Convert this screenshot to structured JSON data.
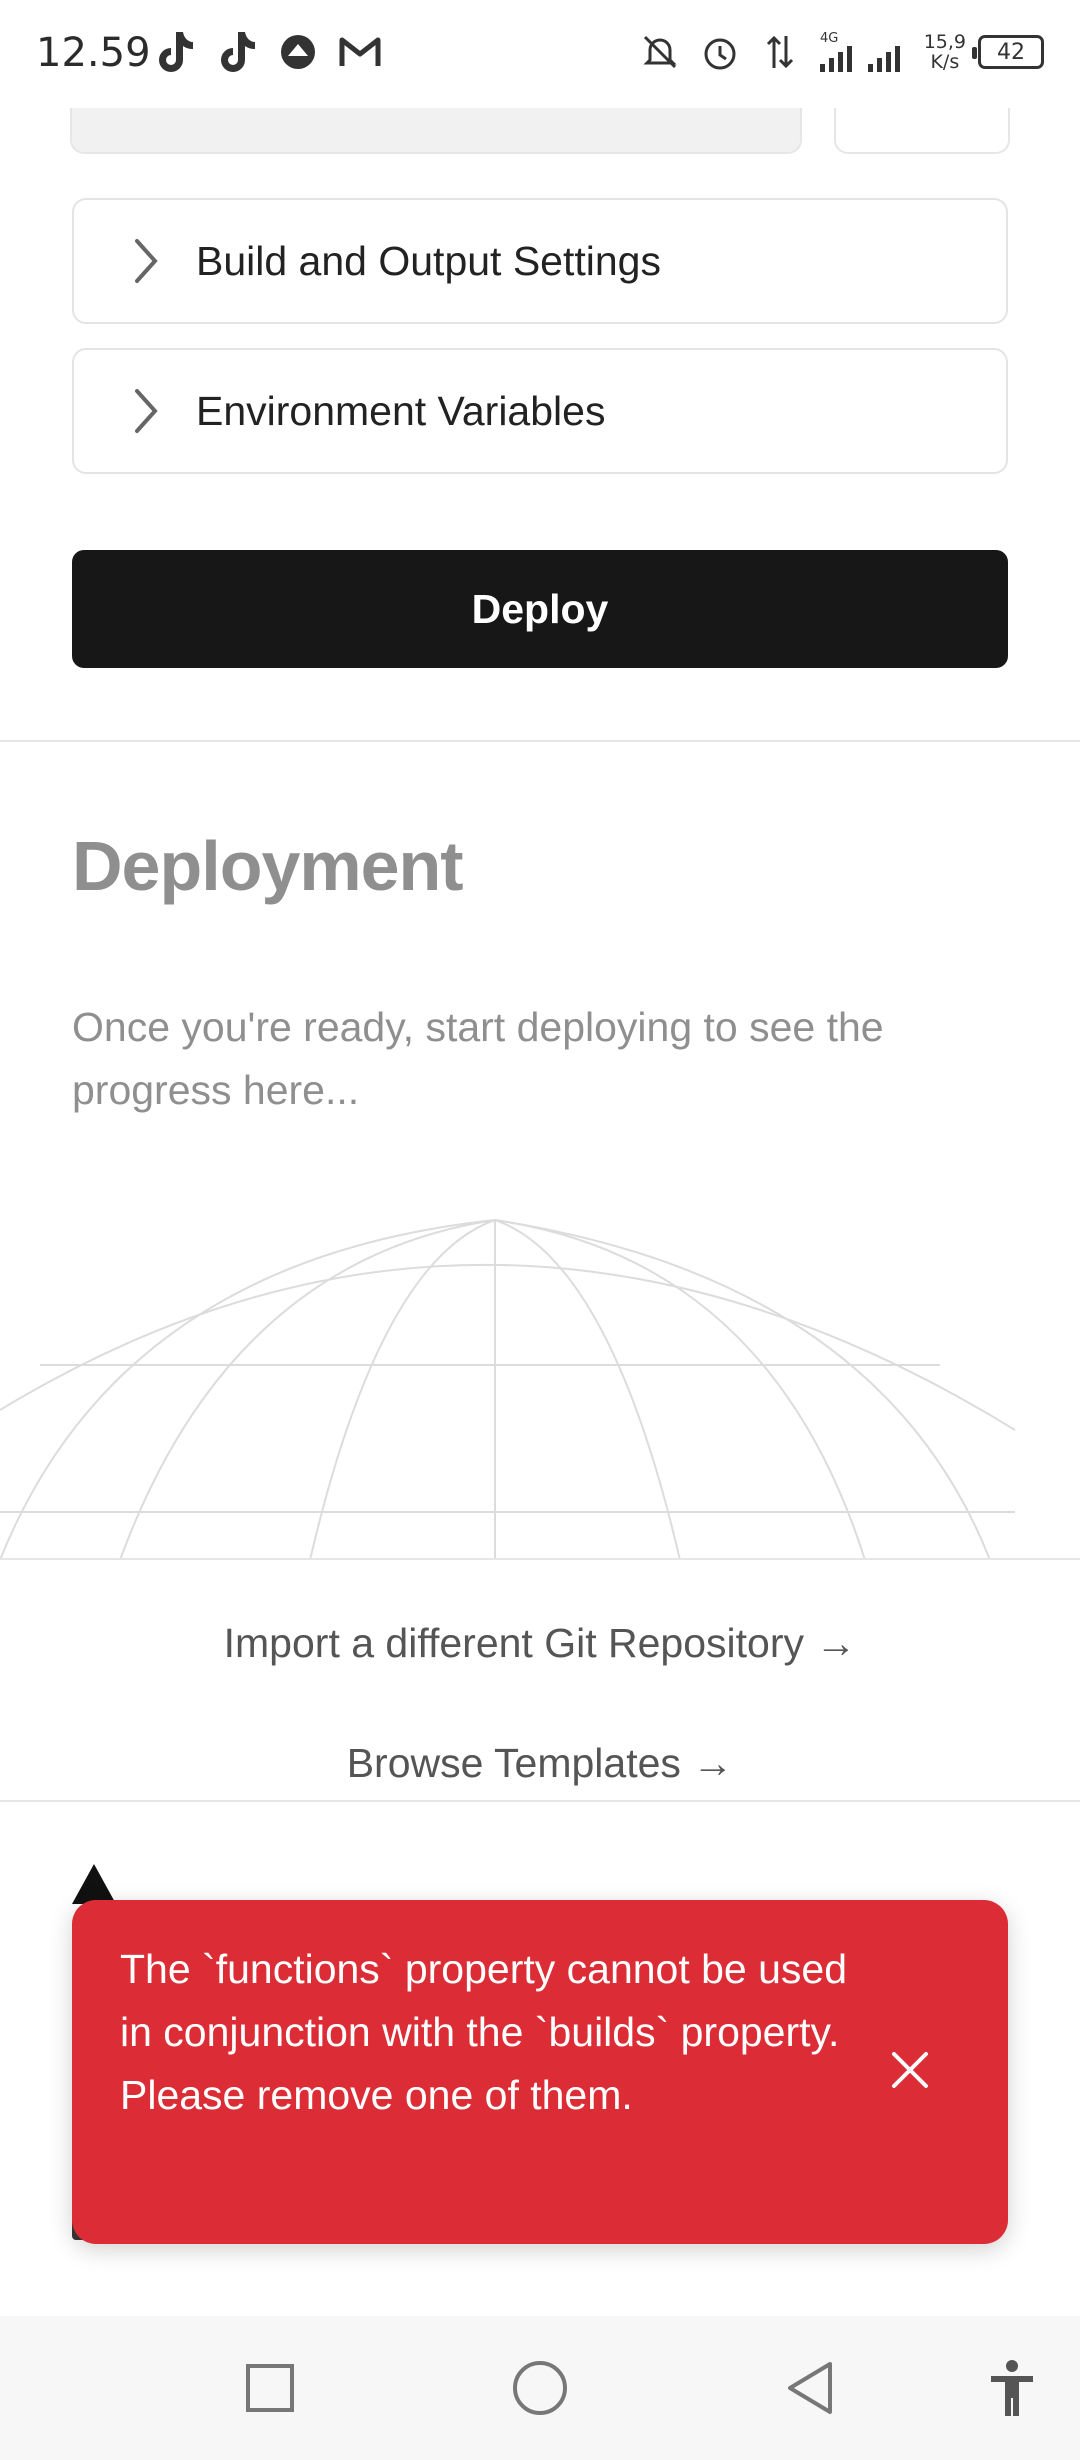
{
  "status_bar": {
    "time": "12.59",
    "net_speed_value": "15,9",
    "net_speed_unit": "K/s",
    "battery": "42",
    "network_type": "4G"
  },
  "settings": {
    "build_output_label": "Build and Output Settings",
    "env_vars_label": "Environment Variables",
    "deploy_button": "Deploy"
  },
  "deployment": {
    "title": "Deployment",
    "description": "Once you're ready, start deploying to see the progress here..."
  },
  "links": {
    "import_repo": "Import a different Git Repository →",
    "browse_templates": "Browse Templates →"
  },
  "toast": {
    "message": "The `functions` property cannot be used in conjunction with the `builds` property. Please remove one of them."
  },
  "colors": {
    "toast_bg": "#dc2c35",
    "deploy_bg": "#171717",
    "muted_text": "#8f8f8f"
  }
}
